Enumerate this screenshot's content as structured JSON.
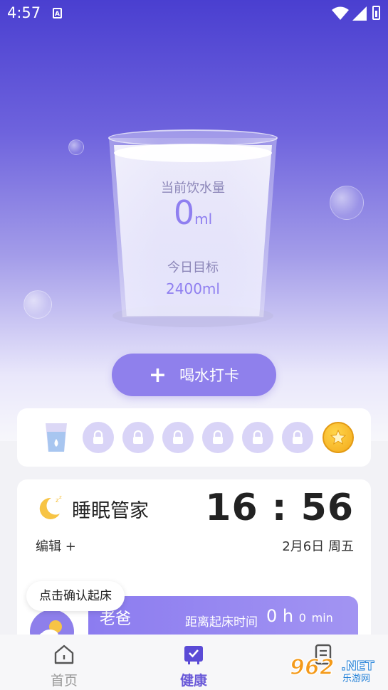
{
  "status_bar": {
    "time": "4:57",
    "a_icon": "A"
  },
  "water": {
    "current_label": "当前饮水量",
    "current_value": "0",
    "current_unit": "ml",
    "goal_label": "今日目标",
    "goal_value": "2400ml",
    "checkin_button": "喝水打卡",
    "cups": {
      "filled": 1,
      "locked": 6,
      "reward": "star-coin-icon"
    }
  },
  "sleep": {
    "title": "睡眠管家",
    "clock": "16 : 56",
    "edit_label": "编辑 +",
    "date": "2月6日 周五",
    "confirm_button": "点击确认起床",
    "alarm_name": "老爸",
    "countdown_label": "距离起床时间",
    "countdown_hours": "0",
    "countdown_hours_unit": "h",
    "countdown_minutes": "0",
    "countdown_minutes_unit": "min"
  },
  "nav": {
    "items": [
      {
        "label": "首页",
        "icon": "home-icon"
      },
      {
        "label": "健康",
        "icon": "health-icon",
        "active": true
      },
      {
        "label": "",
        "icon": "list-icon"
      }
    ]
  },
  "watermark": {
    "text": "962",
    "sub": ".NET",
    "sub2": "乐游网"
  },
  "colors": {
    "accent": "#8f80ec",
    "hero_top": "#4a3fd0",
    "gold": "#f3a91b"
  }
}
